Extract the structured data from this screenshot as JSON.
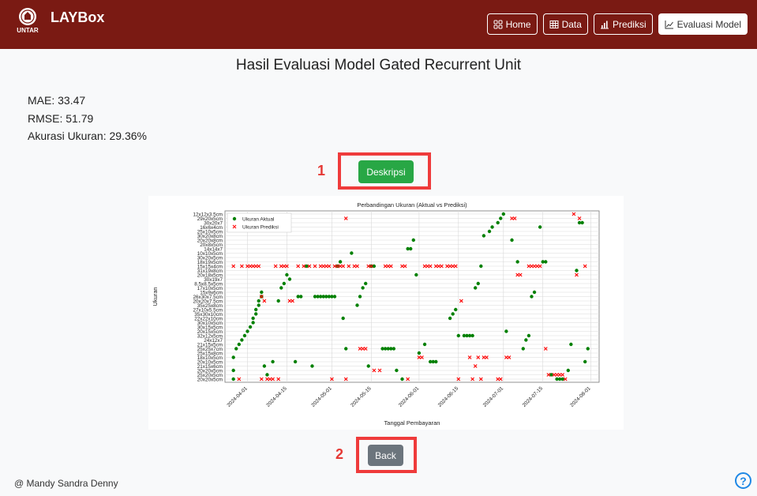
{
  "brand": {
    "logo_text": "UNTAR",
    "name": "LAYBox"
  },
  "nav": [
    {
      "label": "Home",
      "icon": "grid-icon"
    },
    {
      "label": "Data",
      "icon": "table-icon"
    },
    {
      "label": "Prediksi",
      "icon": "bar-chart-icon"
    },
    {
      "label": "Evaluasi Model",
      "icon": "line-chart-icon",
      "active": true
    }
  ],
  "page_title": "Hasil Evaluasi Model Gated Recurrent Unit",
  "metrics": {
    "mae": "MAE: 33.47",
    "rmse": "RMSE: 51.79",
    "accuracy": "Akurasi Ukuran: 29.36%"
  },
  "callouts": {
    "one": "1",
    "two": "2"
  },
  "buttons": {
    "description": "Deskripsi",
    "back": "Back"
  },
  "footer": "@ Mandy Sandra Denny",
  "help_label": "?",
  "colors": {
    "navbar": "#7a1a13",
    "actual": "#008000",
    "predicted": "#ff0000",
    "callout": "#ef3b3b"
  },
  "chart_data": {
    "type": "scatter",
    "title": "Perbandingan Ukuran (Aktual vs Prediksi)",
    "xlabel": "Tanggal Pembayaran",
    "ylabel": "Ukuran",
    "legend": [
      "Ukuran Aktual",
      "Ukuran Prediksi"
    ],
    "legend_position": "top-left",
    "grid": true,
    "x_ticks": [
      "2024-04-01",
      "2024-04-15",
      "2024-05-01",
      "2024-05-15",
      "2024-06-01",
      "2024-06-15",
      "2024-07-01",
      "2024-07-15",
      "2024-08-01"
    ],
    "xlim": [
      "2024-03-24",
      "2024-08-04"
    ],
    "y_categories": [
      "20x20x5cm",
      "25x20x5cm",
      "20x20x5cm",
      "21x15x6cm",
      "20x10x5cm",
      "18x10x5cm",
      "25x15x8cm",
      "25x25x7cm",
      "21x15x5cm",
      "24x12x7",
      "32x12x5cm",
      "20x15x5cm",
      "30x15x5cm",
      "30x10x5cm",
      "22x22x10cm",
      "35x30x10cm",
      "27x10x5.5cm",
      "35x25x8cm",
      "20x20x7.5cm",
      "26x30x7.5cm",
      "15x9x6cm",
      "17x10x5cm",
      "8.5x8.5x5cm",
      "30x19x7",
      "20x18x5cm",
      "31x19x8cm",
      "15x15x4cm",
      "18x19x5cm",
      "30x20x5cm",
      "10x10x5cm",
      "14x14x7",
      "20x8x5cm",
      "20x20x8cm",
      "30x20x8cm",
      "25x10x5cm",
      "16x6x4cm",
      "30x20x7",
      "29x20x5cm",
      "12x12x3.5cm"
    ],
    "series": [
      {
        "name": "Ukuran Aktual",
        "marker": "circle",
        "points": [
          [
            "2024-03-27",
            0
          ],
          [
            "2024-03-27",
            2
          ],
          [
            "2024-03-27",
            5
          ],
          [
            "2024-03-28",
            7
          ],
          [
            "2024-03-29",
            8
          ],
          [
            "2024-03-30",
            9
          ],
          [
            "2024-03-31",
            10
          ],
          [
            "2024-04-01",
            11
          ],
          [
            "2024-04-02",
            12
          ],
          [
            "2024-04-03",
            13
          ],
          [
            "2024-04-03",
            14
          ],
          [
            "2024-04-04",
            15
          ],
          [
            "2024-04-04",
            16
          ],
          [
            "2024-04-05",
            17
          ],
          [
            "2024-04-05",
            18
          ],
          [
            "2024-04-06",
            19
          ],
          [
            "2024-04-06",
            20
          ],
          [
            "2024-04-07",
            3
          ],
          [
            "2024-04-08",
            1
          ],
          [
            "2024-04-10",
            4
          ],
          [
            "2024-04-12",
            18
          ],
          [
            "2024-04-13",
            21
          ],
          [
            "2024-04-14",
            22
          ],
          [
            "2024-04-15",
            24
          ],
          [
            "2024-04-16",
            23
          ],
          [
            "2024-04-18",
            4
          ],
          [
            "2024-04-19",
            19
          ],
          [
            "2024-04-20",
            19
          ],
          [
            "2024-04-22",
            26
          ],
          [
            "2024-04-24",
            3
          ],
          [
            "2024-04-25",
            19
          ],
          [
            "2024-04-26",
            19
          ],
          [
            "2024-04-27",
            19
          ],
          [
            "2024-04-28",
            19
          ],
          [
            "2024-04-29",
            19
          ],
          [
            "2024-04-30",
            19
          ],
          [
            "2024-05-01",
            19
          ],
          [
            "2024-05-02",
            19
          ],
          [
            "2024-05-03",
            26
          ],
          [
            "2024-05-04",
            27
          ],
          [
            "2024-05-05",
            14
          ],
          [
            "2024-05-06",
            7
          ],
          [
            "2024-05-08",
            29
          ],
          [
            "2024-05-10",
            17
          ],
          [
            "2024-05-11",
            19
          ],
          [
            "2024-05-12",
            21
          ],
          [
            "2024-05-13",
            22
          ],
          [
            "2024-05-14",
            3
          ],
          [
            "2024-05-15",
            26
          ],
          [
            "2024-05-16",
            26
          ],
          [
            "2024-05-19",
            7
          ],
          [
            "2024-05-20",
            7
          ],
          [
            "2024-05-21",
            7
          ],
          [
            "2024-05-22",
            7
          ],
          [
            "2024-05-23",
            7
          ],
          [
            "2024-05-24",
            2
          ],
          [
            "2024-05-26",
            0
          ],
          [
            "2024-05-28",
            30
          ],
          [
            "2024-05-29",
            30
          ],
          [
            "2024-05-30",
            32
          ],
          [
            "2024-05-31",
            24
          ],
          [
            "2024-06-01",
            6
          ],
          [
            "2024-06-03",
            8
          ],
          [
            "2024-06-05",
            4
          ],
          [
            "2024-06-06",
            4
          ],
          [
            "2024-06-07",
            4
          ],
          [
            "2024-06-12",
            14
          ],
          [
            "2024-06-13",
            15
          ],
          [
            "2024-06-14",
            16
          ],
          [
            "2024-06-15",
            10
          ],
          [
            "2024-06-17",
            10
          ],
          [
            "2024-06-18",
            10
          ],
          [
            "2024-06-19",
            10
          ],
          [
            "2024-06-20",
            10
          ],
          [
            "2024-06-21",
            21
          ],
          [
            "2024-06-22",
            22
          ],
          [
            "2024-06-23",
            26
          ],
          [
            "2024-06-24",
            33
          ],
          [
            "2024-06-26",
            34
          ],
          [
            "2024-06-27",
            35
          ],
          [
            "2024-06-29",
            36
          ],
          [
            "2024-06-30",
            37
          ],
          [
            "2024-07-01",
            38
          ],
          [
            "2024-07-02",
            11
          ],
          [
            "2024-07-04",
            32
          ],
          [
            "2024-07-06",
            27
          ],
          [
            "2024-07-08",
            7
          ],
          [
            "2024-07-09",
            9
          ],
          [
            "2024-07-10",
            10
          ],
          [
            "2024-07-11",
            19
          ],
          [
            "2024-07-12",
            20
          ],
          [
            "2024-07-14",
            35
          ],
          [
            "2024-07-15",
            27
          ],
          [
            "2024-07-16",
            27
          ],
          [
            "2024-07-18",
            1
          ],
          [
            "2024-07-20",
            0
          ],
          [
            "2024-07-21",
            0
          ],
          [
            "2024-07-22",
            0
          ],
          [
            "2024-07-24",
            2
          ],
          [
            "2024-07-25",
            8
          ],
          [
            "2024-07-27",
            25
          ],
          [
            "2024-07-28",
            36
          ],
          [
            "2024-07-29",
            36
          ],
          [
            "2024-07-30",
            4
          ],
          [
            "2024-07-31",
            7
          ]
        ]
      },
      {
        "name": "Ukuran Prediksi",
        "marker": "x",
        "points": [
          [
            "2024-03-27",
            26
          ],
          [
            "2024-03-29",
            0
          ],
          [
            "2024-03-30",
            26
          ],
          [
            "2024-04-01",
            26
          ],
          [
            "2024-04-02",
            26
          ],
          [
            "2024-04-03",
            26
          ],
          [
            "2024-04-04",
            26
          ],
          [
            "2024-04-05",
            26
          ],
          [
            "2024-04-06",
            0
          ],
          [
            "2024-04-06",
            19
          ],
          [
            "2024-04-07",
            18
          ],
          [
            "2024-04-08",
            0
          ],
          [
            "2024-04-09",
            0
          ],
          [
            "2024-04-10",
            0
          ],
          [
            "2024-04-11",
            26
          ],
          [
            "2024-04-12",
            0
          ],
          [
            "2024-04-13",
            26
          ],
          [
            "2024-04-14",
            26
          ],
          [
            "2024-04-15",
            26
          ],
          [
            "2024-04-16",
            18
          ],
          [
            "2024-04-17",
            18
          ],
          [
            "2024-04-19",
            26
          ],
          [
            "2024-04-21",
            26
          ],
          [
            "2024-04-23",
            26
          ],
          [
            "2024-04-25",
            26
          ],
          [
            "2024-04-27",
            26
          ],
          [
            "2024-04-28",
            26
          ],
          [
            "2024-04-29",
            26
          ],
          [
            "2024-04-30",
            26
          ],
          [
            "2024-05-01",
            0
          ],
          [
            "2024-05-02",
            26
          ],
          [
            "2024-05-03",
            26
          ],
          [
            "2024-05-04",
            26
          ],
          [
            "2024-05-05",
            26
          ],
          [
            "2024-05-06",
            37
          ],
          [
            "2024-05-06",
            0
          ],
          [
            "2024-05-07",
            26
          ],
          [
            "2024-05-09",
            26
          ],
          [
            "2024-05-10",
            26
          ],
          [
            "2024-05-11",
            7
          ],
          [
            "2024-05-12",
            7
          ],
          [
            "2024-05-13",
            7
          ],
          [
            "2024-05-14",
            26
          ],
          [
            "2024-05-15",
            26
          ],
          [
            "2024-05-16",
            2
          ],
          [
            "2024-05-18",
            2
          ],
          [
            "2024-05-20",
            26
          ],
          [
            "2024-05-21",
            26
          ],
          [
            "2024-05-22",
            26
          ],
          [
            "2024-05-26",
            26
          ],
          [
            "2024-05-27",
            26
          ],
          [
            "2024-05-28",
            0
          ],
          [
            "2024-06-01",
            5
          ],
          [
            "2024-06-02",
            5
          ],
          [
            "2024-06-03",
            26
          ],
          [
            "2024-06-04",
            26
          ],
          [
            "2024-06-05",
            26
          ],
          [
            "2024-06-07",
            26
          ],
          [
            "2024-06-08",
            26
          ],
          [
            "2024-06-09",
            26
          ],
          [
            "2024-06-11",
            26
          ],
          [
            "2024-06-12",
            26
          ],
          [
            "2024-06-13",
            26
          ],
          [
            "2024-06-14",
            26
          ],
          [
            "2024-06-15",
            0
          ],
          [
            "2024-06-16",
            18
          ],
          [
            "2024-06-19",
            5
          ],
          [
            "2024-06-20",
            0
          ],
          [
            "2024-06-21",
            3
          ],
          [
            "2024-06-22",
            5
          ],
          [
            "2024-06-23",
            0
          ],
          [
            "2024-06-24",
            5
          ],
          [
            "2024-06-25",
            5
          ],
          [
            "2024-06-29",
            0
          ],
          [
            "2024-06-30",
            0
          ],
          [
            "2024-07-02",
            5
          ],
          [
            "2024-07-03",
            5
          ],
          [
            "2024-07-04",
            37
          ],
          [
            "2024-07-05",
            37
          ],
          [
            "2024-07-06",
            24
          ],
          [
            "2024-07-07",
            24
          ],
          [
            "2024-07-10",
            26
          ],
          [
            "2024-07-11",
            26
          ],
          [
            "2024-07-12",
            26
          ],
          [
            "2024-07-13",
            26
          ],
          [
            "2024-07-14",
            26
          ],
          [
            "2024-07-16",
            7
          ],
          [
            "2024-07-17",
            1
          ],
          [
            "2024-07-19",
            1
          ],
          [
            "2024-07-20",
            1
          ],
          [
            "2024-07-21",
            1
          ],
          [
            "2024-07-22",
            1
          ],
          [
            "2024-07-23",
            0
          ],
          [
            "2024-07-26",
            38
          ],
          [
            "2024-07-27",
            24
          ],
          [
            "2024-07-28",
            37
          ],
          [
            "2024-07-30",
            26
          ]
        ]
      }
    ]
  }
}
